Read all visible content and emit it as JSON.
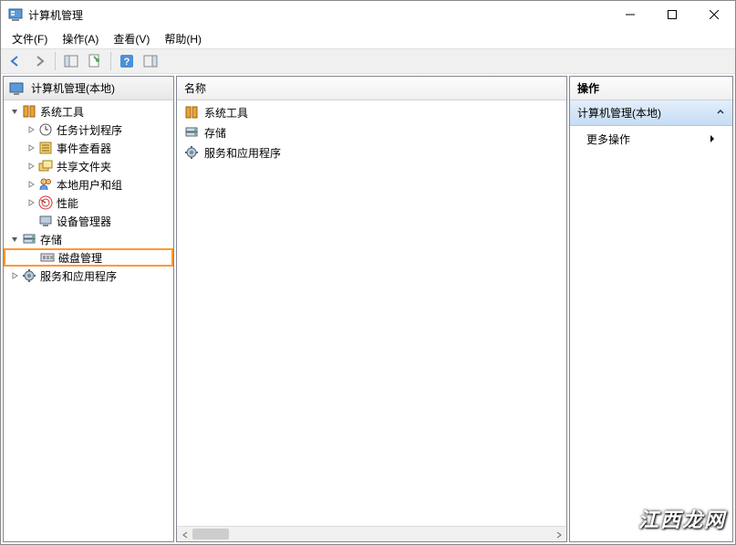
{
  "window": {
    "title": "计算机管理"
  },
  "menubar": {
    "items": [
      "文件(F)",
      "操作(A)",
      "查看(V)",
      "帮助(H)"
    ]
  },
  "tree": {
    "root_label": "计算机管理(本地)",
    "nodes": [
      {
        "depth": 0,
        "expanded": true,
        "label": "系统工具",
        "icon": "tools"
      },
      {
        "depth": 1,
        "expanded": false,
        "label": "任务计划程序",
        "icon": "clock"
      },
      {
        "depth": 1,
        "expanded": false,
        "label": "事件查看器",
        "icon": "event"
      },
      {
        "depth": 1,
        "expanded": false,
        "label": "共享文件夹",
        "icon": "share"
      },
      {
        "depth": 1,
        "expanded": false,
        "label": "本地用户和组",
        "icon": "users"
      },
      {
        "depth": 1,
        "expanded": false,
        "label": "性能",
        "icon": "perf"
      },
      {
        "depth": 1,
        "expanded": null,
        "label": "设备管理器",
        "icon": "device"
      },
      {
        "depth": 0,
        "expanded": true,
        "label": "存储",
        "icon": "storage"
      },
      {
        "depth": 1,
        "expanded": null,
        "label": "磁盘管理",
        "icon": "disk",
        "highlighted": true
      },
      {
        "depth": 0,
        "expanded": false,
        "label": "服务和应用程序",
        "icon": "services"
      }
    ]
  },
  "list": {
    "header": "名称",
    "items": [
      {
        "label": "系统工具",
        "icon": "tools"
      },
      {
        "label": "存储",
        "icon": "storage"
      },
      {
        "label": "服务和应用程序",
        "icon": "services"
      }
    ]
  },
  "actions": {
    "header": "操作",
    "section_title": "计算机管理(本地)",
    "items": [
      "更多操作"
    ]
  },
  "watermark": "江西龙网"
}
